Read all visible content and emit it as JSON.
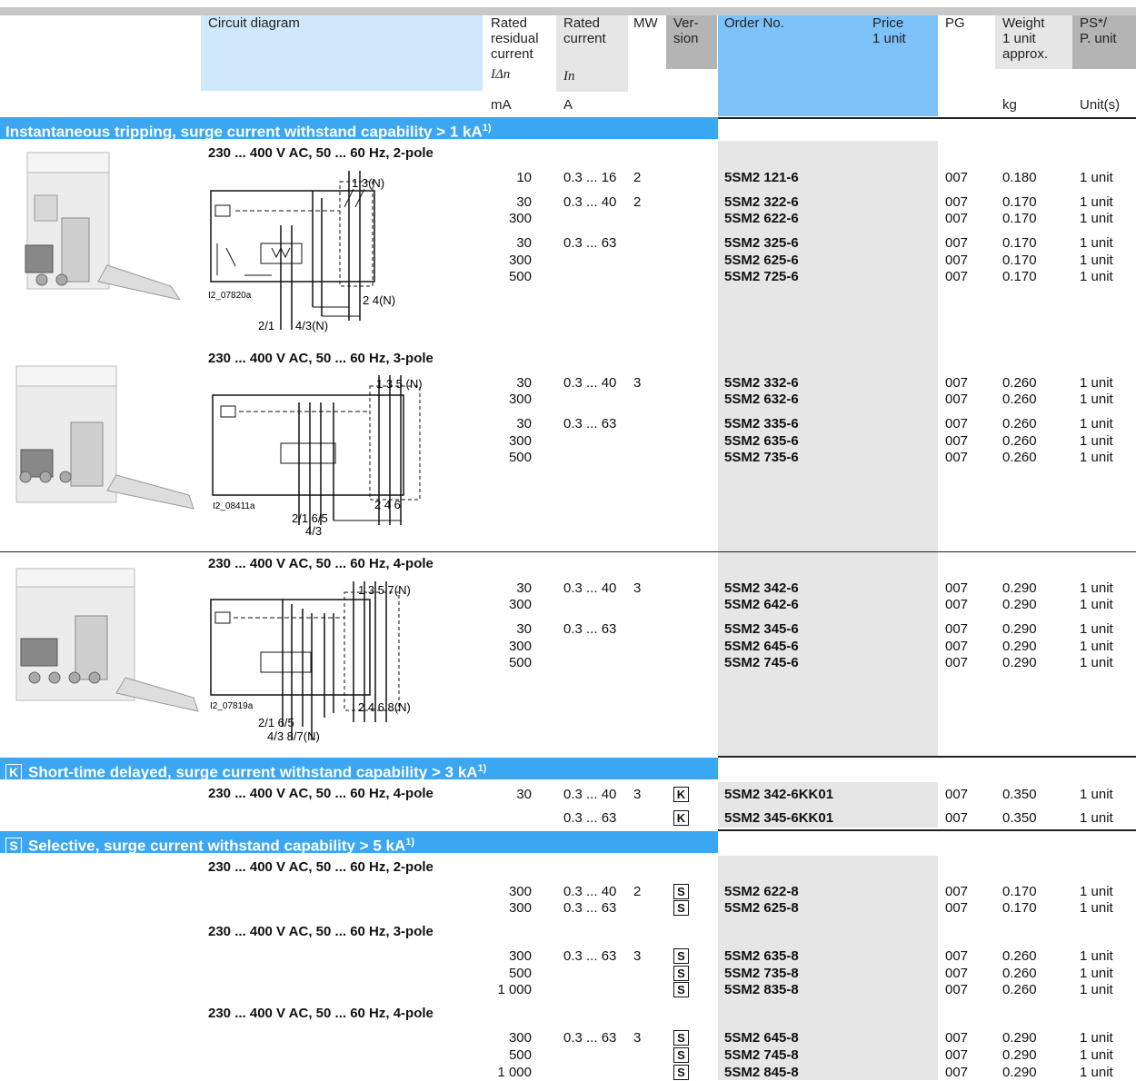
{
  "header": {
    "col_diagram": "Circuit diagram",
    "col_rated_residual": "Rated\nresidual\ncurrent",
    "col_rated_residual_sym": "IΔn",
    "col_rated_current": "Rated\ncurrent",
    "col_rated_current_sym": "In",
    "col_mw": "MW",
    "col_version": "Ver-\nsion",
    "col_order": "Order No.",
    "col_price": "Price\n1 unit",
    "col_pg": "PG",
    "col_weight": "Weight\n1 unit\napprox.",
    "col_ps": "PS*/\nP. unit",
    "unit_ma": "mA",
    "unit_a": "A",
    "unit_kg": "kg",
    "unit_units": "Unit(s)"
  },
  "sections": {
    "instantaneous": {
      "title": "Instantaneous tripping, surge current withstand capability > 1 kA",
      "sup": "1)"
    },
    "short_time": {
      "badge": "K",
      "title": "Short-time delayed, surge current withstand capability > 3 kA",
      "sup": "1)"
    },
    "selective": {
      "badge": "S",
      "title": "Selective, surge current withstand capability > 5 kA",
      "sup": "1)"
    }
  },
  "subheads": {
    "inst_2pole": "230 ... 400 V AC, 50 ... 60 Hz, 2-pole",
    "inst_3pole": "230 ... 400 V AC, 50 ... 60 Hz, 3-pole",
    "inst_4pole": "230 ... 400 V AC, 50 ... 60 Hz, 4-pole",
    "sel_2pole": "230 ... 400 V AC, 50 ... 60 Hz, 2-pole",
    "sel_3pole": "230 ... 400 V AC, 50 ... 60 Hz, 3-pole",
    "sel_4pole": "230 ... 400 V AC, 50 ... 60 Hz, 4-pole"
  },
  "short_time_row_label": "230 ... 400 V AC, 50 ... 60 Hz, 4-pole",
  "diagrams": {
    "d2": {
      "id": "I2_07820a",
      "top": "1 3(N)",
      "bot1": "2 4(N)",
      "bot2": "2/1",
      "bot3": "4/3(N)"
    },
    "d3": {
      "id": "I2_08411a",
      "top": "1 3 5 (N)",
      "bot1": "2 4 6",
      "bot2": "2/1  6/5",
      "bot3": "4/3"
    },
    "d4": {
      "id": "I2_07819a",
      "top": "1 3 5 7(N)",
      "bot1": "2 4 6 8(N)",
      "bot2": "2/1  6/5",
      "bot3": "4/3  8/7(N)"
    }
  },
  "rows": {
    "r1": {
      "ma": "10",
      "in": "0.3 ... 16",
      "mw": "2",
      "order": "5SM2 121-6",
      "pg": "007",
      "wt": "0.180",
      "ps": "1 unit"
    },
    "r2": {
      "ma": "30",
      "in": "0.3 ... 40",
      "mw": "2",
      "order": "5SM2 322-6",
      "pg": "007",
      "wt": "0.170",
      "ps": "1 unit"
    },
    "r3": {
      "ma": "300",
      "in": "",
      "mw": "",
      "order": "5SM2 622-6",
      "pg": "007",
      "wt": "0.170",
      "ps": "1 unit"
    },
    "r4": {
      "ma": "30",
      "in": "0.3 ... 63",
      "mw": "",
      "order": "5SM2 325-6",
      "pg": "007",
      "wt": "0.170",
      "ps": "1 unit"
    },
    "r5": {
      "ma": "300",
      "in": "",
      "mw": "",
      "order": "5SM2 625-6",
      "pg": "007",
      "wt": "0.170",
      "ps": "1 unit"
    },
    "r6": {
      "ma": "500",
      "in": "",
      "mw": "",
      "order": "5SM2 725-6",
      "pg": "007",
      "wt": "0.170",
      "ps": "1 unit"
    },
    "r7": {
      "ma": "30",
      "in": "0.3 ... 40",
      "mw": "3",
      "order": "5SM2 332-6",
      "pg": "007",
      "wt": "0.260",
      "ps": "1 unit"
    },
    "r8": {
      "ma": "300",
      "in": "",
      "mw": "",
      "order": "5SM2 632-6",
      "pg": "007",
      "wt": "0.260",
      "ps": "1 unit"
    },
    "r9": {
      "ma": "30",
      "in": "0.3 ... 63",
      "mw": "",
      "order": "5SM2 335-6",
      "pg": "007",
      "wt": "0.260",
      "ps": "1 unit"
    },
    "r10": {
      "ma": "300",
      "in": "",
      "mw": "",
      "order": "5SM2 635-6",
      "pg": "007",
      "wt": "0.260",
      "ps": "1 unit"
    },
    "r11": {
      "ma": "500",
      "in": "",
      "mw": "",
      "order": "5SM2 735-6",
      "pg": "007",
      "wt": "0.260",
      "ps": "1 unit"
    },
    "r12": {
      "ma": "30",
      "in": "0.3 ... 40",
      "mw": "3",
      "order": "5SM2 342-6",
      "pg": "007",
      "wt": "0.290",
      "ps": "1 unit"
    },
    "r13": {
      "ma": "300",
      "in": "",
      "mw": "",
      "order": "5SM2 642-6",
      "pg": "007",
      "wt": "0.290",
      "ps": "1 unit"
    },
    "r14": {
      "ma": "30",
      "in": "0.3 ... 63",
      "mw": "",
      "order": "5SM2 345-6",
      "pg": "007",
      "wt": "0.290",
      "ps": "1 unit"
    },
    "r15": {
      "ma": "300",
      "in": "",
      "mw": "",
      "order": "5SM2 645-6",
      "pg": "007",
      "wt": "0.290",
      "ps": "1 unit"
    },
    "r16": {
      "ma": "500",
      "in": "",
      "mw": "",
      "order": "5SM2 745-6",
      "pg": "007",
      "wt": "0.290",
      "ps": "1 unit"
    },
    "k1": {
      "ma": "30",
      "in": "0.3 ... 40",
      "mw": "3",
      "ver": "K",
      "order": "5SM2 342-6KK01",
      "pg": "007",
      "wt": "0.350",
      "ps": "1 unit"
    },
    "k2": {
      "ma": "",
      "in": "0.3 ... 63",
      "mw": "",
      "ver": "K",
      "order": "5SM2 345-6KK01",
      "pg": "007",
      "wt": "0.350",
      "ps": "1 unit"
    },
    "s1": {
      "ma": "300",
      "in": "0.3 ... 40",
      "mw": "2",
      "ver": "S",
      "order": "5SM2 622-8",
      "pg": "007",
      "wt": "0.170",
      "ps": "1 unit"
    },
    "s2": {
      "ma": "300",
      "in": "0.3 ... 63",
      "mw": "",
      "ver": "S",
      "order": "5SM2 625-8",
      "pg": "007",
      "wt": "0.170",
      "ps": "1 unit"
    },
    "s3": {
      "ma": "300",
      "in": "0.3 ... 63",
      "mw": "3",
      "ver": "S",
      "order": "5SM2 635-8",
      "pg": "007",
      "wt": "0.260",
      "ps": "1 unit"
    },
    "s4": {
      "ma": "500",
      "in": "",
      "mw": "",
      "ver": "S",
      "order": "5SM2 735-8",
      "pg": "007",
      "wt": "0.260",
      "ps": "1 unit"
    },
    "s5": {
      "ma": "1 000",
      "in": "",
      "mw": "",
      "ver": "S",
      "order": "5SM2 835-8",
      "pg": "007",
      "wt": "0.260",
      "ps": "1 unit"
    },
    "s6": {
      "ma": "300",
      "in": "0.3 ... 63",
      "mw": "3",
      "ver": "S",
      "order": "5SM2 645-8",
      "pg": "007",
      "wt": "0.290",
      "ps": "1 unit"
    },
    "s7": {
      "ma": "500",
      "in": "",
      "mw": "",
      "ver": "S",
      "order": "5SM2 745-8",
      "pg": "007",
      "wt": "0.290",
      "ps": "1 unit"
    },
    "s8": {
      "ma": "1 000",
      "in": "",
      "mw": "",
      "ver": "S",
      "order": "5SM2 845-8",
      "pg": "007",
      "wt": "0.290",
      "ps": "1 unit"
    }
  },
  "colors": {
    "section_blue": "#3ba6f2",
    "order_header_blue": "#7ec2fa",
    "light_blue": "#cfe8fb",
    "grey": "#e6e6e6",
    "dark_grey": "#b4b4b4"
  }
}
